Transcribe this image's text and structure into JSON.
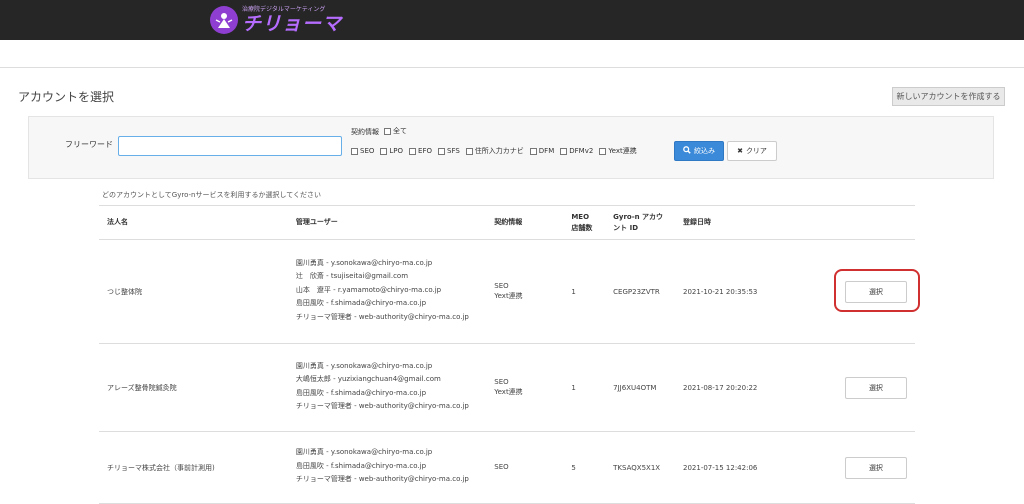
{
  "header": {
    "logo_tagline": "治療院デジタルマーケティング",
    "logo_text": "チリョーマ"
  },
  "page": {
    "title": "アカウントを選択",
    "new_account_label": "新しいアカウントを作成する",
    "instruction": "どのアカウントとしてGyro-nサービスを利用するか選択してください"
  },
  "filter": {
    "freeword_label": "フリーワード",
    "freeword_value": "",
    "contract_label": "契約情報",
    "all_label": "全て",
    "options": [
      "SEO",
      "LPO",
      "EFO",
      "SFS",
      "住所入力カナビ",
      "DFM",
      "DFMv2",
      "Yext連携"
    ],
    "search_label": "絞込み",
    "clear_label": "クリア"
  },
  "table": {
    "headers": [
      "法人名",
      "管理ユーザー",
      "契約情報",
      "MEO 店舗数",
      "Gyro-n アカウント ID",
      "登録日時",
      ""
    ],
    "select_label": "選択",
    "rows": [
      {
        "name": "つじ整体院",
        "users": [
          "園川勇真 - y.sonokawa@chiryo-ma.co.jp",
          "辻　欣斎 - tsujiseitai@gmail.com",
          "山本　遼平 - r.yamamoto@chiryo-ma.co.jp",
          "島田風吹 - f.shimada@chiryo-ma.co.jp",
          "チリョーマ管理者 - web-authority@chiryo-ma.co.jp"
        ],
        "contracts": [
          "SEO",
          "Yext連携"
        ],
        "meo": "1",
        "account_id": "CEGP23ZVTR",
        "registered": "2021-10-21 20:35:53"
      },
      {
        "name": "アレーズ整骨院鍼灸院",
        "users": [
          "園川勇真 - y.sonokawa@chiryo-ma.co.jp",
          "大嶋恒太郎 - yuzixiangchuan4@gmail.com",
          "島田風吹 - f.shimada@chiryo-ma.co.jp",
          "チリョーマ管理者 - web-authority@chiryo-ma.co.jp"
        ],
        "contracts": [
          "SEO",
          "Yext連携"
        ],
        "meo": "1",
        "account_id": "7JJ6XU4OTM",
        "registered": "2021-08-17 20:20:22"
      },
      {
        "name": "チリョーマ株式会社（事前計測用)",
        "users": [
          "園川勇真 - y.sonokawa@chiryo-ma.co.jp",
          "島田風吹 - f.shimada@chiryo-ma.co.jp",
          "チリョーマ管理者 - web-authority@chiryo-ma.co.jp"
        ],
        "contracts": [
          "SEO"
        ],
        "meo": "5",
        "account_id": "TKSAQX5X1X",
        "registered": "2021-07-15 12:42:06"
      }
    ]
  },
  "colors": {
    "topbar": "#262626",
    "logo": "#b56cff",
    "primary_button": "#3b8ad9",
    "highlight": "#d03030"
  }
}
